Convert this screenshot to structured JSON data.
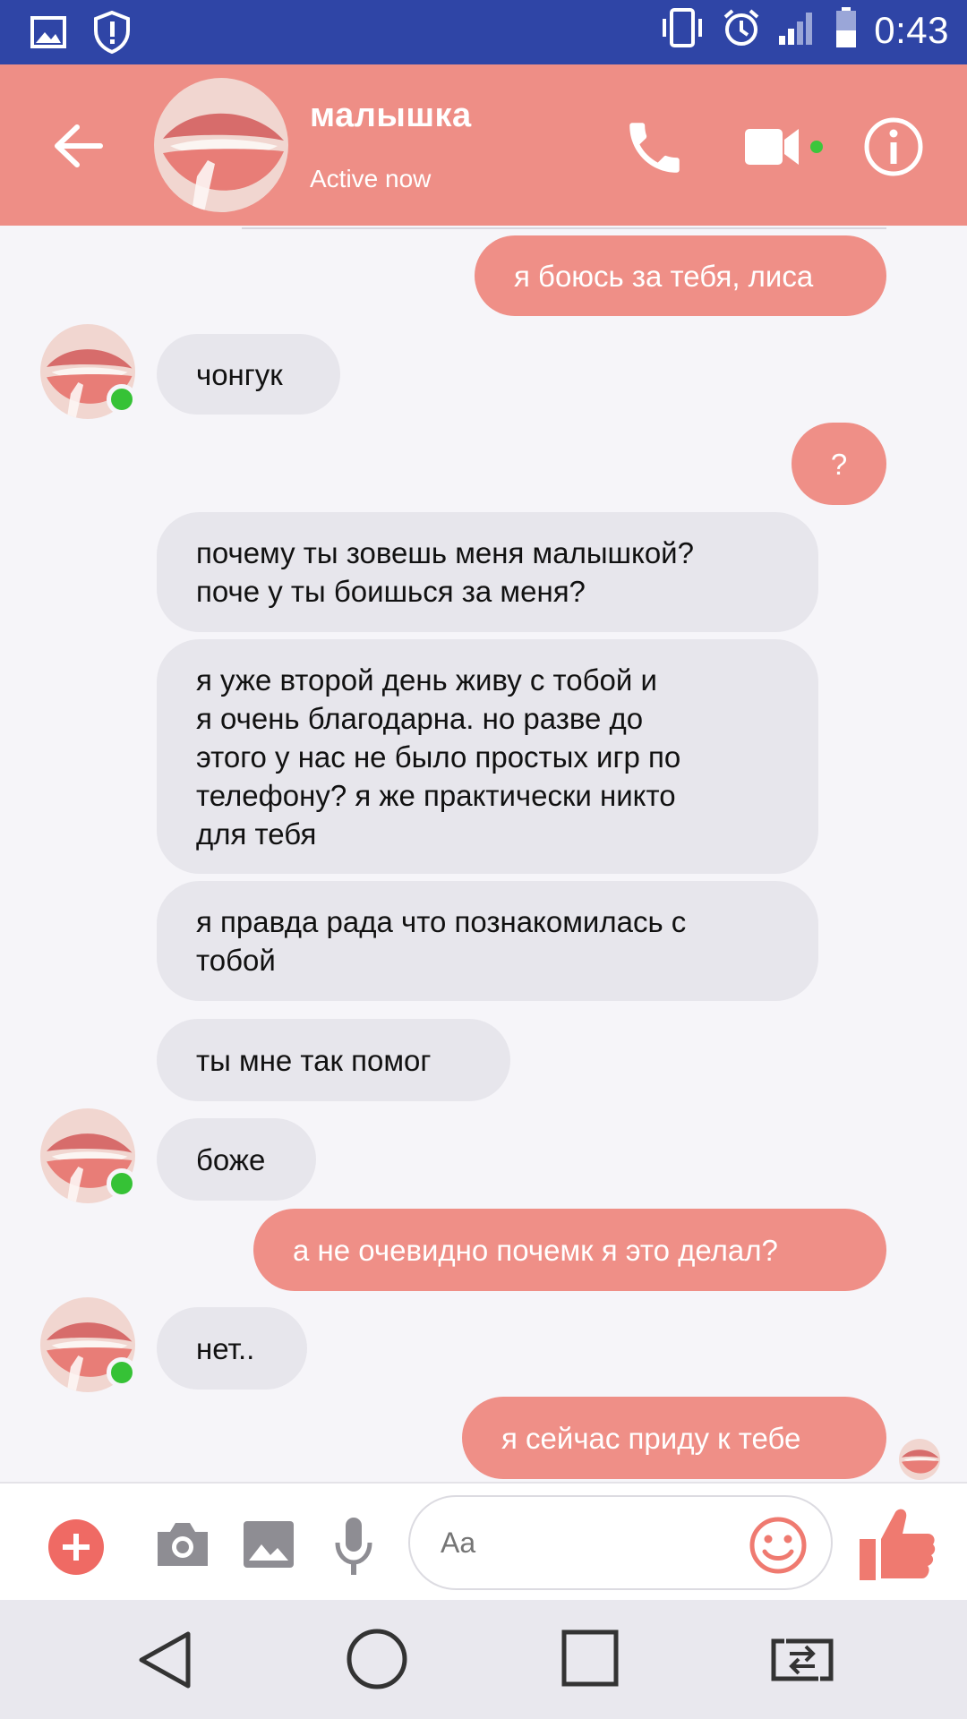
{
  "status_bar": {
    "time": "0:43",
    "icons": [
      "image-icon",
      "shield-alert-icon",
      "vibrate-icon",
      "alarm-icon",
      "signal-icon",
      "battery-icon"
    ]
  },
  "header": {
    "contact_name": "малышка",
    "status": "Active now",
    "accent_color": "#ee8e86",
    "icons": [
      "back-arrow-icon",
      "phone-icon",
      "video-camera-icon",
      "info-icon"
    ]
  },
  "messages": [
    {
      "side": "out",
      "lines": [
        "я боюсь за тебя, лиса"
      ]
    },
    {
      "side": "in",
      "lines": [
        "чонгук"
      ]
    },
    {
      "side": "out",
      "lines": [
        "?"
      ]
    },
    {
      "side": "in",
      "lines": [
        "почему ты зовешь меня малышкой?",
        "поче у ты боишься за меня?"
      ]
    },
    {
      "side": "in",
      "lines": [
        "я уже второй день живу с тобой и",
        "я очень благодарна. но разве до",
        "этого у нас не было простых игр по",
        "телефону? я же практически никто",
        "для тебя"
      ]
    },
    {
      "side": "in",
      "lines": [
        "я правда рада что познакомилась с",
        "тобой"
      ]
    },
    {
      "side": "in",
      "lines": [
        "ты мне так помог"
      ]
    },
    {
      "side": "in",
      "lines": [
        "боже"
      ]
    },
    {
      "side": "out",
      "lines": [
        "а не очевидно почемк я это делал?"
      ]
    },
    {
      "side": "in",
      "lines": [
        "нет.."
      ]
    },
    {
      "side": "out",
      "lines": [
        "я сейчас приду к тебе"
      ]
    }
  ],
  "composer": {
    "placeholder": "Aa",
    "icons": [
      "plus-icon",
      "camera-icon",
      "image-icon",
      "microphone-icon",
      "emoji-icon",
      "thumbs-up-icon"
    ]
  },
  "nav_bar": {
    "icons": [
      "nav-back-icon",
      "nav-home-icon",
      "nav-recents-icon",
      "nav-switch-icon"
    ]
  }
}
